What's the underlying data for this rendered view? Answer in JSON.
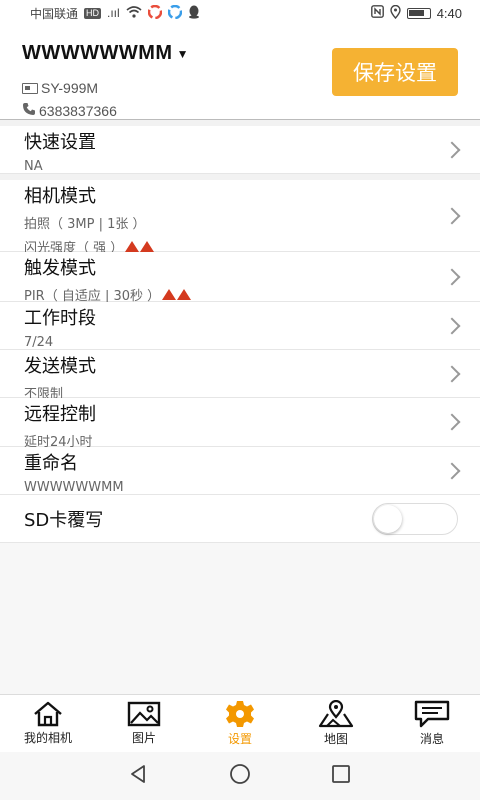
{
  "status_bar": {
    "carrier": "中国联通",
    "network_badge": "HD",
    "signal": ".ııl",
    "time": "4:40"
  },
  "header": {
    "device_name": "WWWWWWMM",
    "serial": "SY-999M",
    "phone": "6383837366",
    "save_label": "保存设置"
  },
  "rows": {
    "quick": {
      "title": "快速设置",
      "sub": "NA"
    },
    "camera": {
      "title": "相机模式",
      "sub": "拍照（ 3MP | 1张 ）",
      "sub2": "闪光强度（ 强 ）"
    },
    "trigger": {
      "title": "触发模式",
      "sub": "PIR（ 自适应 | 30秒 ）"
    },
    "worktime": {
      "title": "工作时段",
      "sub": "7/24"
    },
    "send": {
      "title": "发送模式",
      "sub": "不限制"
    },
    "remote": {
      "title": "远程控制",
      "sub": "延时24小时"
    },
    "rename": {
      "title": "重命名",
      "sub": "WWWWWWMM"
    },
    "sd": {
      "title": "SD卡覆写",
      "toggle_on": false
    }
  },
  "bottom_nav": {
    "items": [
      {
        "label": "我的相机",
        "icon": "home-icon"
      },
      {
        "label": "图片",
        "icon": "image-icon"
      },
      {
        "label": "设置",
        "icon": "gear-icon"
      },
      {
        "label": "地图",
        "icon": "map-icon"
      },
      {
        "label": "消息",
        "icon": "message-icon"
      }
    ],
    "active_index": 2,
    "active_color": "#f39800"
  },
  "colors": {
    "accent": "#f5b233",
    "warning": "#d43a1f"
  }
}
